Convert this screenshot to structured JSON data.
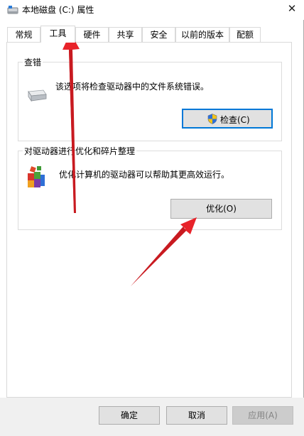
{
  "window": {
    "title": "本地磁盘 (C:) 属性",
    "close_glyph": "✕"
  },
  "tabs": [
    {
      "label": "常规"
    },
    {
      "label": "工具",
      "selected": true
    },
    {
      "label": "硬件"
    },
    {
      "label": "共享"
    },
    {
      "label": "安全"
    },
    {
      "label": "以前的版本"
    },
    {
      "label": "配额"
    }
  ],
  "error_check": {
    "title": "查错",
    "description": "该选项将检查驱动器中的文件系统错误。",
    "icon": "drive-icon",
    "button_label": "检查(C)",
    "button_icon": "uac-shield-icon"
  },
  "optimize": {
    "title": "对驱动器进行优化和碎片整理",
    "description": "优化计算机的驱动器可以帮助其更高效运行。",
    "icon": "defrag-icon",
    "button_label": "优化(O)"
  },
  "footer": {
    "ok_label": "确定",
    "cancel_label": "取消",
    "apply_label": "应用(A)"
  },
  "colors": {
    "annotation_arrow": "#e8232a",
    "focus_border": "#0078d7",
    "button_face": "#e1e1e1",
    "footer_bg": "#f0f0f0"
  }
}
